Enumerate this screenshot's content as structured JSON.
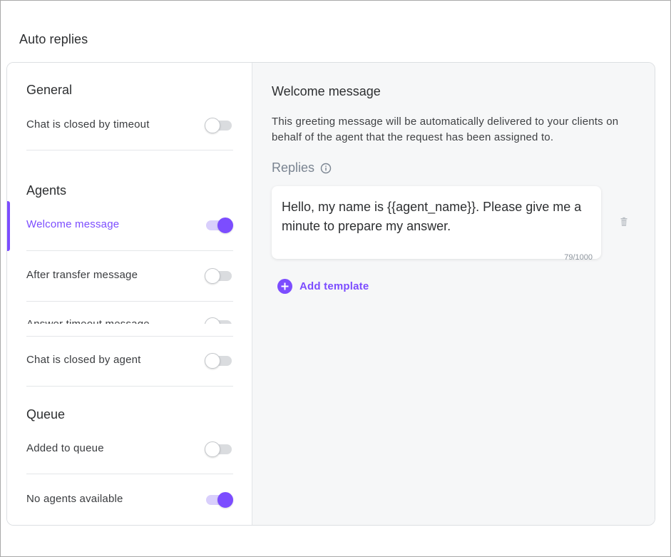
{
  "page": {
    "title": "Auto replies"
  },
  "colors": {
    "accent": "#7c4dff",
    "muted": "#7a8491"
  },
  "sidebar": {
    "sections": [
      {
        "title": "General",
        "items": [
          {
            "label": "Chat is closed by timeout",
            "enabled": false,
            "active": false
          }
        ]
      },
      {
        "title": "Agents",
        "items": [
          {
            "label": "Welcome message",
            "enabled": true,
            "active": true
          },
          {
            "label": "After transfer message",
            "enabled": false,
            "active": false
          },
          {
            "label": "Answer timeout message",
            "enabled": false,
            "active": false
          },
          {
            "label": "Chat is closed by agent",
            "enabled": false,
            "active": false
          }
        ]
      },
      {
        "title": "Queue",
        "items": [
          {
            "label": "Added to queue",
            "enabled": false,
            "active": false
          },
          {
            "label": "No agents available",
            "enabled": true,
            "active": false
          }
        ]
      }
    ]
  },
  "main": {
    "title": "Welcome message",
    "description": "This greeting message will be automatically delivered to your clients on behalf of the agent that the request has been assigned to.",
    "replies_label": "Replies",
    "replies": [
      {
        "text": "Hello, my name is {{agent_name}}. Please give me a minute to prepare my answer.",
        "count": "79/1000"
      }
    ],
    "add_template_label": "Add template",
    "icons": {
      "info": "info-icon",
      "delete": "trash-icon",
      "add": "plus-icon"
    }
  }
}
